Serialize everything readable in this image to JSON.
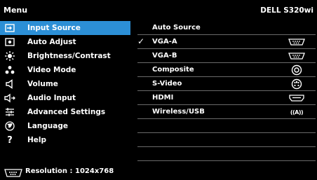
{
  "header": {
    "title": "Menu",
    "model": "DELL S320wi"
  },
  "menu": {
    "items": [
      {
        "label": "Input Source",
        "icon": "input-source-icon",
        "selected": true
      },
      {
        "label": "Auto Adjust",
        "icon": "auto-adjust-icon"
      },
      {
        "label": "Brightness/Contrast",
        "icon": "brightness-icon"
      },
      {
        "label": "Video Mode",
        "icon": "video-mode-icon"
      },
      {
        "label": "Volume",
        "icon": "volume-icon"
      },
      {
        "label": "Audio Input",
        "icon": "audio-input-icon"
      },
      {
        "label": "Advanced Settings",
        "icon": "advanced-settings-icon"
      },
      {
        "label": "Language",
        "icon": "language-icon"
      },
      {
        "label": "Help",
        "icon": "help-icon"
      }
    ]
  },
  "submenu": {
    "rows": [
      {
        "label": "Auto Source",
        "checked": false,
        "icon": ""
      },
      {
        "label": "VGA-A",
        "checked": true,
        "check_mark": "✓",
        "icon": "vga-connector-icon"
      },
      {
        "label": "VGA-B",
        "checked": false,
        "icon": "vga-connector-icon"
      },
      {
        "label": "Composite",
        "checked": false,
        "icon": "composite-connector-icon"
      },
      {
        "label": "S-Video",
        "checked": false,
        "icon": "s-video-connector-icon"
      },
      {
        "label": "HDMI",
        "checked": false,
        "icon": "hdmi-connector-icon"
      },
      {
        "label": "Wireless/USB",
        "checked": false,
        "icon": "wireless-icon",
        "icon_text": "((A))"
      },
      {
        "label": "",
        "checked": false,
        "icon": ""
      },
      {
        "label": "",
        "checked": false,
        "icon": ""
      },
      {
        "label": "",
        "checked": false,
        "icon": ""
      }
    ]
  },
  "status": {
    "text": "Resolution : 1024x768",
    "icon": "vga-connector-icon"
  },
  "colors": {
    "background": "#000000",
    "highlight": "#2c8fd6",
    "separator": "#6a6a6a",
    "text": "#ffffff"
  }
}
